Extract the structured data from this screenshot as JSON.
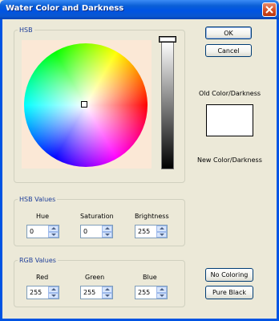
{
  "window": {
    "title": "Water Color and Darkness"
  },
  "hsb_group": {
    "legend": "HSB"
  },
  "buttons": {
    "ok": "OK",
    "cancel": "Cancel",
    "no_coloring": "No Coloring",
    "pure_black": "Pure Black"
  },
  "color_preview": {
    "old_label": "Old Color/Darkness",
    "new_label": "New Color/Darkness"
  },
  "hsb_values": {
    "legend": "HSB Values",
    "hue": {
      "label": "Hue",
      "value": "0"
    },
    "saturation": {
      "label": "Saturation",
      "value": "0"
    },
    "brightness": {
      "label": "Brightness",
      "value": "255"
    }
  },
  "rgb_values": {
    "legend": "RGB Values",
    "red": {
      "label": "Red",
      "value": "255"
    },
    "green": {
      "label": "Green",
      "value": "255"
    },
    "blue": {
      "label": "Blue",
      "value": "255"
    }
  }
}
